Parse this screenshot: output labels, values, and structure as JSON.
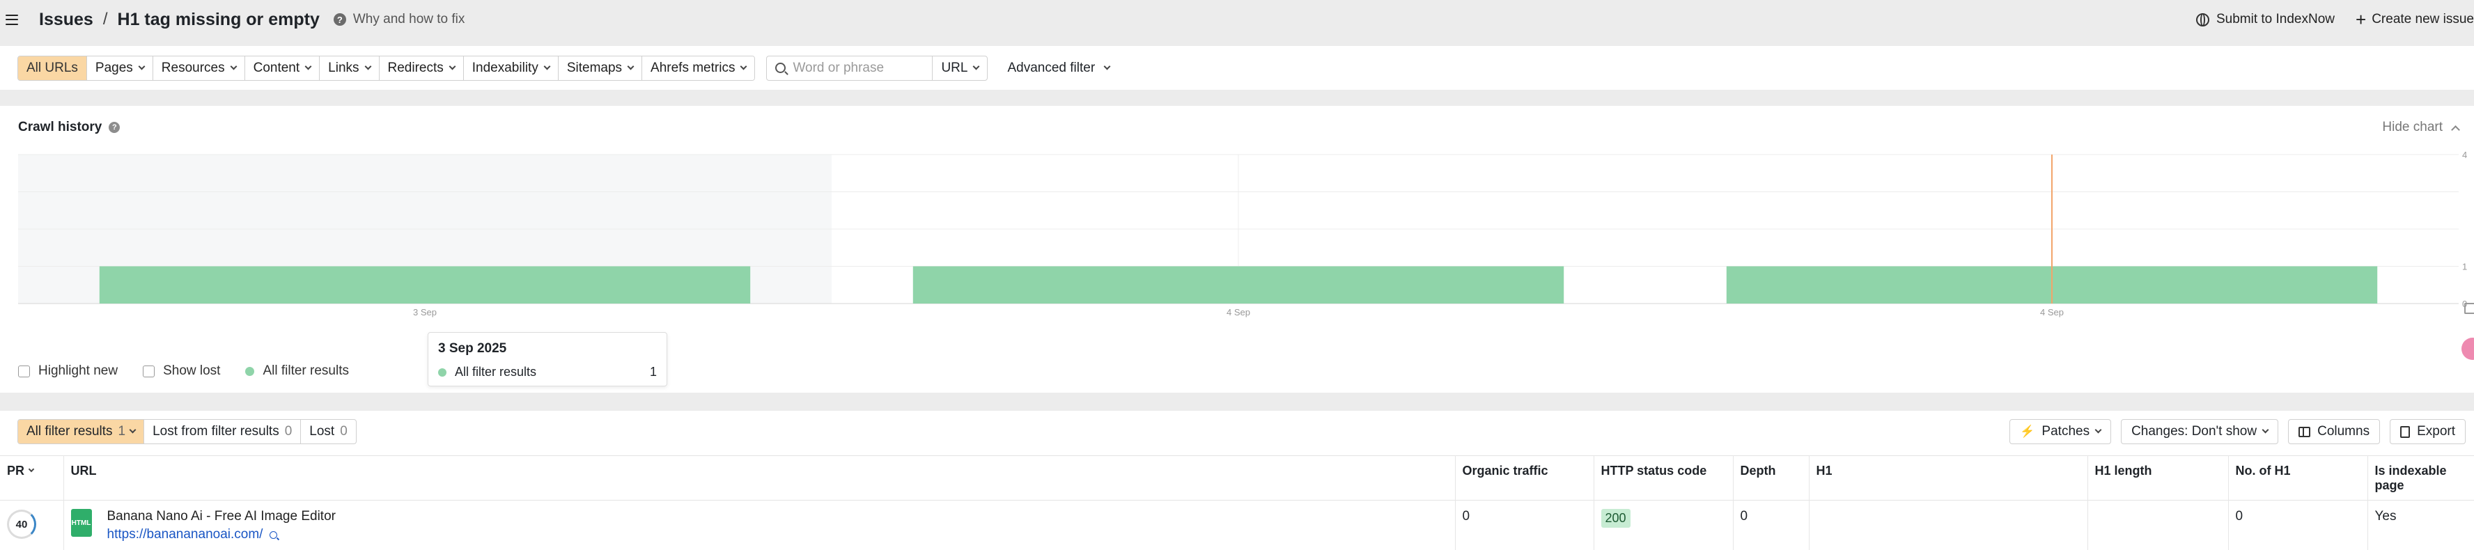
{
  "header": {
    "breadcrumb_root": "Issues",
    "separator": "/",
    "page_title": "H1 tag missing or empty",
    "why_link": "Why and how to fix",
    "submit_indexnow": "Submit to IndexNow",
    "create_issue": "Create new issue"
  },
  "filters": {
    "groups": [
      {
        "label": "All URLs",
        "active": true,
        "dropdown": false
      },
      {
        "label": "Pages",
        "dropdown": true
      },
      {
        "label": "Resources",
        "dropdown": true
      },
      {
        "label": "Content",
        "dropdown": true
      },
      {
        "label": "Links",
        "dropdown": true
      },
      {
        "label": "Redirects",
        "dropdown": true
      },
      {
        "label": "Indexability",
        "dropdown": true
      },
      {
        "label": "Sitemaps",
        "dropdown": true
      },
      {
        "label": "Ahrefs metrics",
        "dropdown": true
      }
    ],
    "search_placeholder": "Word or phrase",
    "search_scope": "URL",
    "advanced_filter": "Advanced filter"
  },
  "crawl_history": {
    "title": "Crawl history",
    "hide_chart": "Hide chart",
    "tooltip": {
      "date": "3 Sep 2025",
      "series": "All filter results",
      "value": "1"
    },
    "legend": {
      "highlight_new": "Highlight new",
      "show_lost": "Show lost",
      "all_filter_results": "All filter results"
    }
  },
  "chart_data": {
    "type": "bar",
    "categories": [
      "3 Sep",
      "4 Sep",
      "4 Sep"
    ],
    "series": [
      {
        "name": "All filter results",
        "values": [
          1,
          1,
          1
        ]
      }
    ],
    "y_ticks": [
      "0",
      "1",
      "4"
    ],
    "ylim": [
      0,
      4
    ],
    "grid": true,
    "colors": {
      "bar": "#8fd4a9",
      "marker": "#f2a56b",
      "shaded": "#f6f7f8"
    }
  },
  "results": {
    "tabs": [
      {
        "label": "All filter results",
        "count": "1",
        "active": true
      },
      {
        "label": "Lost from filter results",
        "count": "0"
      },
      {
        "label": "Lost",
        "count": "0"
      }
    ],
    "patches": "Patches",
    "changes": "Changes: Don't show",
    "columns": "Columns",
    "export": "Export"
  },
  "table": {
    "headers": {
      "pr": "PR",
      "url": "URL",
      "organic_traffic": "Organic traffic",
      "http_status": "HTTP status code",
      "depth": "Depth",
      "h1": "H1",
      "h1_length": "H1 length",
      "no_h1": "No. of H1",
      "indexable": "Is indexable page"
    },
    "rows": [
      {
        "pr": "40",
        "file_type": "HTML",
        "title": "Banana Nano Ai - Free AI Image Editor",
        "url": "https://bananananoai.com/",
        "organic_traffic": "0",
        "http_status": "200",
        "depth": "0",
        "h1": "",
        "h1_length": "",
        "no_h1": "0",
        "indexable": "Yes"
      }
    ]
  }
}
